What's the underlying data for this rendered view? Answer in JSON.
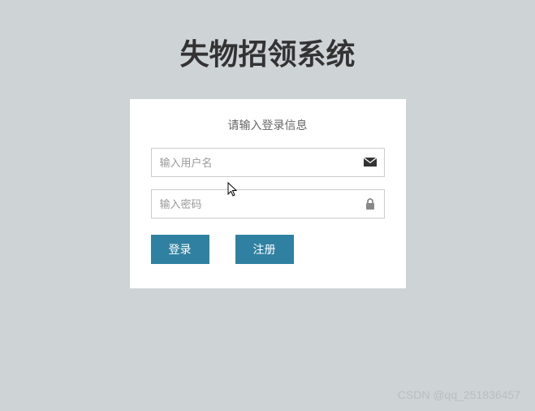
{
  "title": "失物招领系统",
  "panel": {
    "header": "请输入登录信息",
    "username": {
      "placeholder": "输入用户名",
      "value": ""
    },
    "password": {
      "placeholder": "输入密码",
      "value": ""
    },
    "login_label": "登录",
    "register_label": "注册"
  },
  "watermark": "CSDN @qq_251836457"
}
